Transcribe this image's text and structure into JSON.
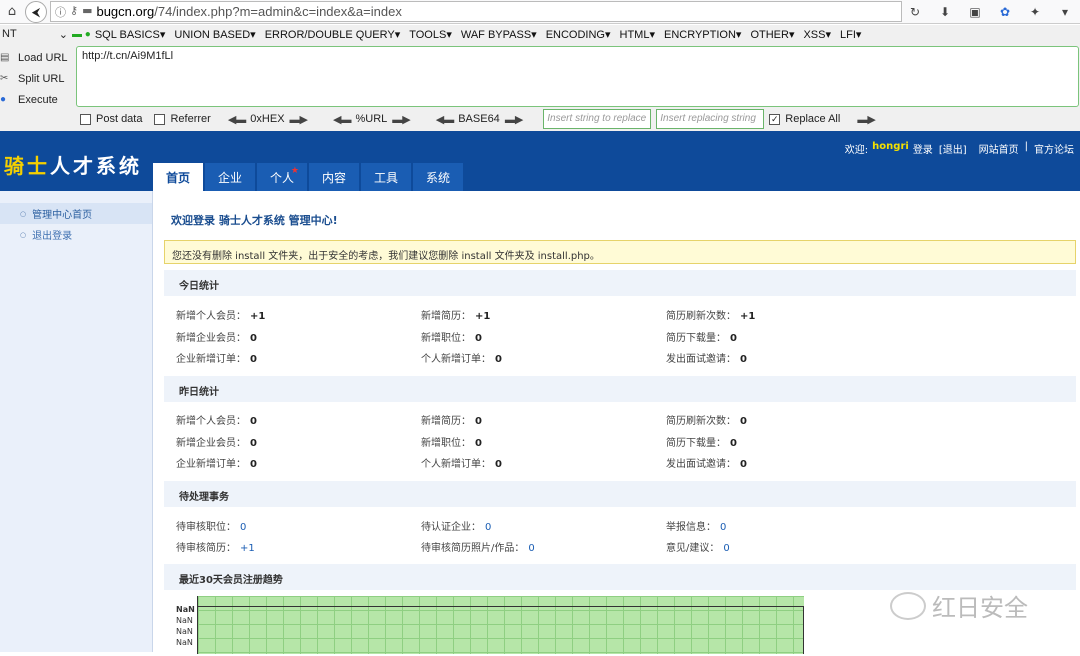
{
  "browser": {
    "url_prefix": "bugcn.org",
    "url_rest": "/74/index.php?m=admin&c=index&a=index",
    "nav_back": "⮜",
    "right_icons": [
      "↻",
      "⬇",
      "▣",
      "✿",
      "✦",
      "▾"
    ]
  },
  "hackbar": {
    "select_label": "NT",
    "menu": [
      "SQL BASICS",
      "UNION BASED",
      "ERROR/DOUBLE QUERY",
      "TOOLS",
      "WAF BYPASS",
      "ENCODING",
      "HTML",
      "ENCRYPTION",
      "OTHER",
      "XSS",
      "LFI"
    ],
    "actions": [
      "Load URL",
      "Split URL",
      "Execute"
    ],
    "textarea_value": "http://t.cn/Ai9M1fLl",
    "post_data": "Post data",
    "referrer": "Referrer",
    "encoders": [
      "0xHEX",
      "%URL",
      "BASE64"
    ],
    "insert_placeholder": "Insert string to replace",
    "replacing_placeholder": "Insert replacing string",
    "replace_all": "Replace All"
  },
  "app": {
    "logo_a": "骑士",
    "logo_b": "人才系统",
    "welcome_prefix": "欢迎:",
    "username": "hongri",
    "login": "登录",
    "logout": "[退出]",
    "site_home": "网站首页",
    "sep": "|",
    "forum": "官方论坛",
    "tabs": [
      "首页",
      "企业",
      "个人",
      "内容",
      "工具",
      "系统"
    ]
  },
  "sidebar": {
    "items": [
      "管理中心首页",
      "退出登录"
    ]
  },
  "main": {
    "title": "欢迎登录 骑士人才系统 管理中心!",
    "notice": "您还没有删除 install 文件夹，出于安全的考虑，我们建议您删除 install 文件夹及 install.php。",
    "today": {
      "heading": "今日统计",
      "rows": [
        [
          {
            "label": "新增个人会员：",
            "value": "+1"
          },
          {
            "label": "新增简历：",
            "value": "+1"
          },
          {
            "label": "简历刷新次数：",
            "value": "+1"
          }
        ],
        [
          {
            "label": "新增企业会员：",
            "value": "0"
          },
          {
            "label": "新增职位：",
            "value": "0"
          },
          {
            "label": "简历下载量：",
            "value": "0"
          }
        ],
        [
          {
            "label": "企业新增订单：",
            "value": "0"
          },
          {
            "label": "个人新增订单：",
            "value": "0"
          },
          {
            "label": "发出面试邀请：",
            "value": "0"
          }
        ]
      ]
    },
    "yesterday": {
      "heading": "昨日统计",
      "rows": [
        [
          {
            "label": "新增个人会员：",
            "value": "0"
          },
          {
            "label": "新增简历：",
            "value": "0"
          },
          {
            "label": "简历刷新次数：",
            "value": "0"
          }
        ],
        [
          {
            "label": "新增企业会员：",
            "value": "0"
          },
          {
            "label": "新增职位：",
            "value": "0"
          },
          {
            "label": "简历下载量：",
            "value": "0"
          }
        ],
        [
          {
            "label": "企业新增订单：",
            "value": "0"
          },
          {
            "label": "个人新增订单：",
            "value": "0"
          },
          {
            "label": "发出面试邀请：",
            "value": "0"
          }
        ]
      ]
    },
    "pending": {
      "heading": "待处理事务",
      "rows": [
        [
          {
            "label": "待审核职位：",
            "value": "0"
          },
          {
            "label": "待认证企业：",
            "value": "0"
          },
          {
            "label": "举报信息：",
            "value": "0"
          }
        ],
        [
          {
            "label": "待审核简历：",
            "value": "+1"
          },
          {
            "label": "待审核简历照片/作品：",
            "value": "0"
          },
          {
            "label": "意见/建议：",
            "value": "0"
          }
        ]
      ]
    },
    "trend": {
      "heading": "最近30天会员注册趋势",
      "ylabels": [
        "NaN",
        "NaN",
        "NaN",
        "NaN"
      ]
    }
  },
  "watermark": "红日安全"
}
